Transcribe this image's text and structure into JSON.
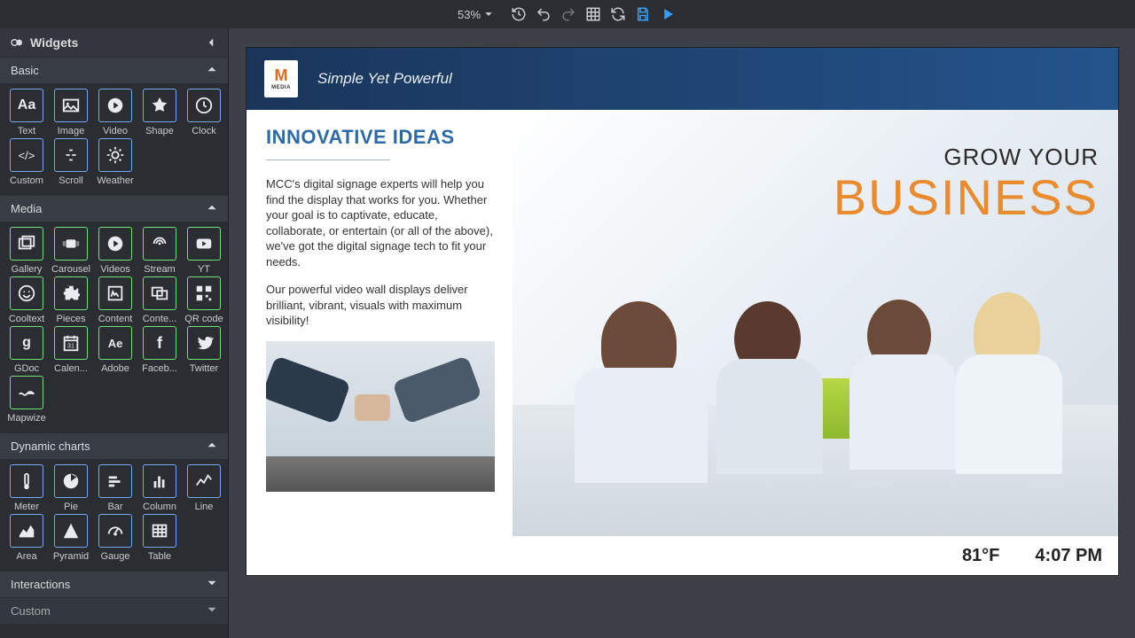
{
  "toolbar": {
    "zoom": "53%"
  },
  "sidebar": {
    "title": "Widgets",
    "sections": {
      "basic": {
        "label": "Basic",
        "items": [
          "Text",
          "Image",
          "Video",
          "Shape",
          "Clock",
          "Custom",
          "Scroll",
          "Weather"
        ]
      },
      "media": {
        "label": "Media",
        "items": [
          "Gallery",
          "Carousel",
          "Videos",
          "Stream",
          "YT",
          "Cooltext",
          "Pieces",
          "Content",
          "Conte...",
          "QR code",
          "GDoc",
          "Calen...",
          "Adobe",
          "Faceb...",
          "Twitter",
          "Mapwize"
        ]
      },
      "charts": {
        "label": "Dynamic charts",
        "items": [
          "Meter",
          "Pie",
          "Bar",
          "Column",
          "Line",
          "Area",
          "Pyramid",
          "Gauge",
          "Table"
        ]
      },
      "interactions": {
        "label": "Interactions"
      },
      "custom": {
        "label": "Custom"
      }
    }
  },
  "canvas": {
    "logo_sub": "MEDIA",
    "tagline": "Simple Yet Powerful",
    "title": "INNOVATIVE IDEAS",
    "para1": "MCC's digital signage experts will help you find the display that works for you. Whether your goal is to captivate, educate, collaborate, or entertain (or all of the above), we've got the digital signage tech to fit your needs.",
    "para2": "Our powerful video wall displays deliver brilliant, vibrant, visuals with maximum visibility!",
    "headline1": "GROW YOUR",
    "headline2": "BUSINESS",
    "temp": "81°F",
    "time": "4:07 PM"
  }
}
